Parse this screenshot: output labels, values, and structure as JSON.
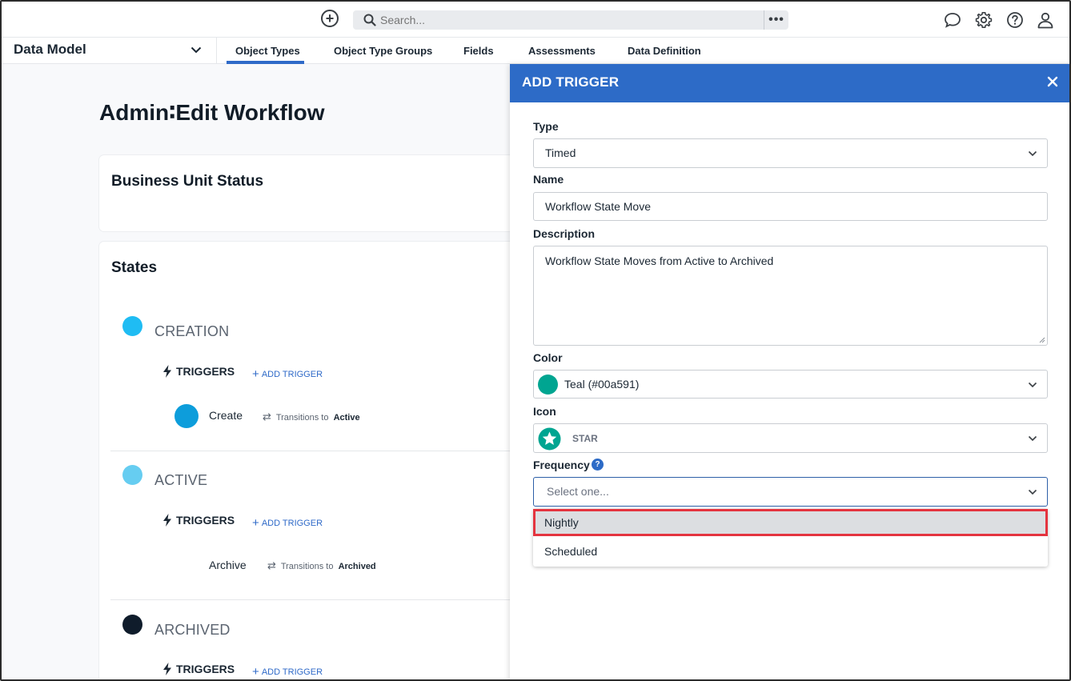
{
  "topbar": {
    "search_placeholder": "Search...",
    "icons": [
      "add-icon",
      "search-icon",
      "more-icon",
      "chat-icon",
      "gear-icon",
      "help-icon",
      "user-icon"
    ]
  },
  "nav": {
    "module": "Data Model",
    "tabs": [
      {
        "label": "Object Types",
        "active": true
      },
      {
        "label": "Object Type Groups",
        "active": false
      },
      {
        "label": "Fields",
        "active": false
      },
      {
        "label": "Assessments",
        "active": false
      },
      {
        "label": "Data Definition",
        "active": false
      }
    ]
  },
  "main": {
    "title": "Admin∶Edit Workflow",
    "workflow_name": "Business Unit Status",
    "states_heading": "States",
    "triggers_label": "TRIGGERS",
    "add_trigger_label": "ADD TRIGGER",
    "transitions_label": "Transitions to",
    "states": [
      {
        "name": "CREATION",
        "color": "#1fbcf3",
        "trigger": {
          "name": "Create",
          "target": "Active",
          "color": "#0d9ddb"
        }
      },
      {
        "name": "ACTIVE",
        "color": "#66cdf1",
        "trigger": {
          "name": "Archive",
          "target": "Archived"
        }
      },
      {
        "name": "ARCHIVED",
        "color": "#0f1c2b"
      }
    ]
  },
  "panel": {
    "title": "ADD TRIGGER",
    "type_label": "Type",
    "type_value": "Timed",
    "name_label": "Name",
    "name_value": "Workflow State Move",
    "description_label": "Description",
    "description_value": "Workflow State Moves from Active to Archived",
    "color_label": "Color",
    "color_value": "Teal (#00a591)",
    "color_swatch": "#00a591",
    "icon_label": "Icon",
    "icon_value": "STAR",
    "frequency_label": "Frequency",
    "frequency_placeholder": "Select one...",
    "frequency_options": [
      {
        "label": "Nightly",
        "highlighted": true
      },
      {
        "label": "Scheduled",
        "highlighted": false
      }
    ]
  },
  "colors": {
    "accent": "#2d6bc7",
    "highlight_border": "#e4343f",
    "highlight_bg": "#dcdee1"
  }
}
